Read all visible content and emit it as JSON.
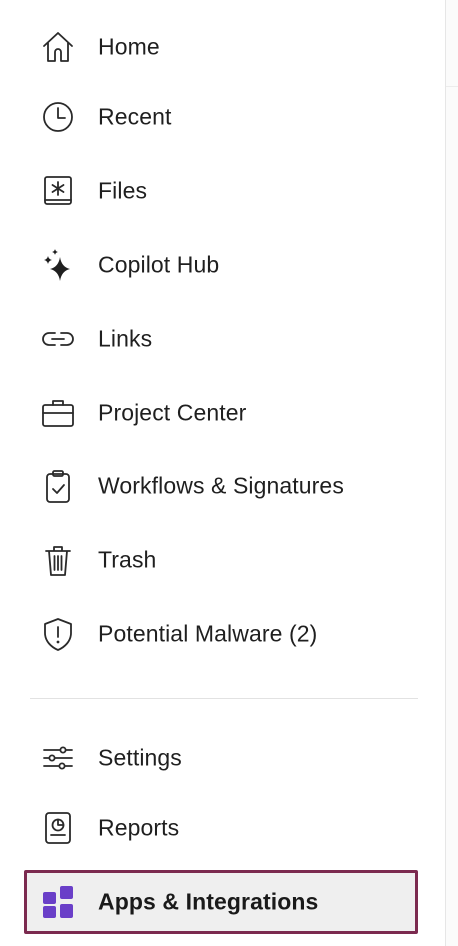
{
  "sidebar": {
    "items": [
      {
        "label": "Home",
        "icon": "home-icon"
      },
      {
        "label": "Recent",
        "icon": "clock-icon"
      },
      {
        "label": "Files",
        "icon": "files-icon"
      },
      {
        "label": "Copilot Hub",
        "icon": "sparkle-icon"
      },
      {
        "label": "Links",
        "icon": "link-icon"
      },
      {
        "label": "Project Center",
        "icon": "briefcase-icon"
      },
      {
        "label": "Workflows & Signatures",
        "icon": "clipboard-check-icon"
      },
      {
        "label": "Trash",
        "icon": "trash-icon"
      },
      {
        "label": "Potential Malware (2)",
        "icon": "shield-alert-icon"
      }
    ],
    "secondary_items": [
      {
        "label": "Settings",
        "icon": "sliders-icon"
      },
      {
        "label": "Reports",
        "icon": "report-icon"
      },
      {
        "label": "Apps & Integrations",
        "icon": "apps-grid-icon",
        "active": true
      }
    ]
  },
  "colors": {
    "active_border": "#7b2a4f",
    "active_background": "#efefef",
    "apps_icon": "#6a3fc8",
    "text": "#1f1f1f"
  }
}
